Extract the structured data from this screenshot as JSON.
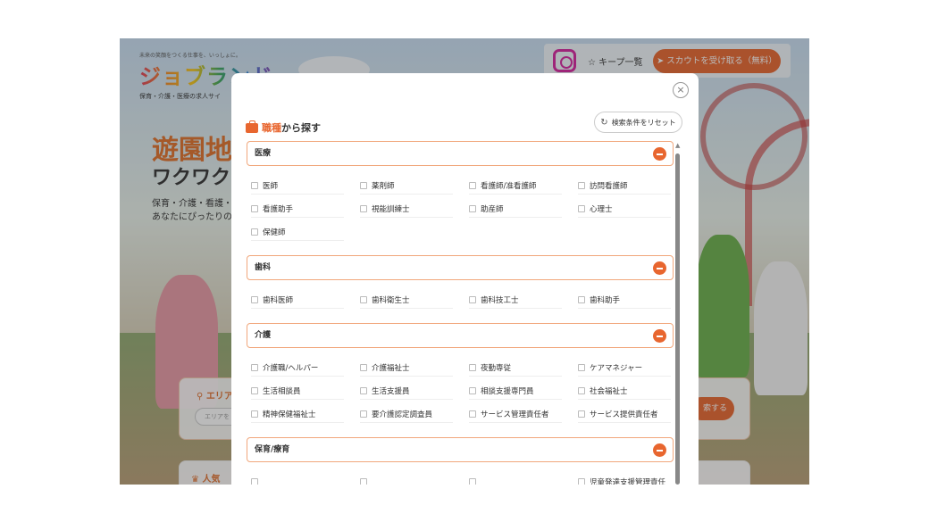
{
  "site": {
    "logo_tagline": "未来の笑顔をつくる仕事を、いっしょに。",
    "logo_text": "ジョブランド",
    "logo_sub": "保育・介護・医療の求人サイ",
    "hero_title": "遊園地",
    "hero_title2": "ワクワク",
    "hero_text_1": "保育・介護・看護・",
    "hero_text_2": "あなたにぴったりの",
    "keep_list": "キープ一覧",
    "scout_button": "スカウトを受け取る（無料）",
    "search_label": "エリア",
    "search_placeholder": "エリアを",
    "search_button": "索する",
    "popular_label": "人気"
  },
  "modal": {
    "title_accent": "職種",
    "title_rest": "から探す",
    "reset_label": "検索条件をリセット",
    "close_symbol": "×",
    "sections": [
      {
        "label": "医療",
        "options": [
          "医師",
          "薬剤師",
          "看護師/准看護師",
          "訪問看護師",
          "看護助手",
          "視能訓練士",
          "助産師",
          "心理士",
          "保健師"
        ]
      },
      {
        "label": "歯科",
        "options": [
          "歯科医師",
          "歯科衛生士",
          "歯科技工士",
          "歯科助手"
        ]
      },
      {
        "label": "介護",
        "options": [
          "介護職/ヘルパー",
          "介護福祉士",
          "夜勤専従",
          "ケアマネジャー",
          "生活相談員",
          "生活支援員",
          "相談支援専門員",
          "社会福祉士",
          "精神保健福祉士",
          "要介護認定調査員",
          "サービス管理責任者",
          "サービス提供責任者"
        ]
      },
      {
        "label": "保育/療育",
        "options": [
          "",
          "",
          "",
          "児童発達支援管理責任"
        ]
      }
    ]
  },
  "colors": {
    "accent": "#e8662f",
    "section_border": "#f1a77c"
  },
  "icons": {
    "close": "close-icon",
    "reset": "reset-icon",
    "bag": "briefcase-icon",
    "collapse": "minus-icon",
    "instagram": "instagram-icon",
    "star": "star-icon",
    "send": "send-icon",
    "pin": "location-pin-icon",
    "crown": "crown-icon"
  }
}
